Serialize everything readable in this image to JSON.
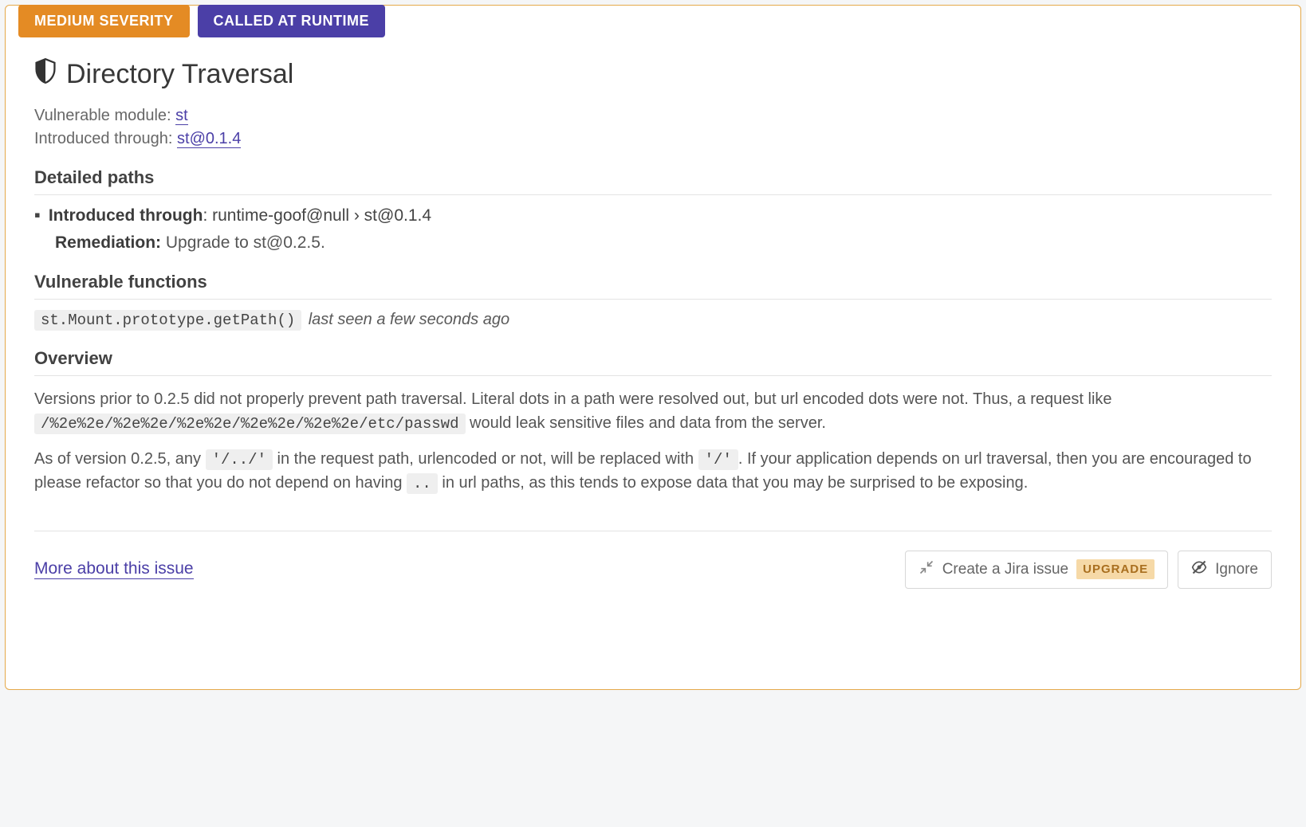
{
  "badges": {
    "severity": "MEDIUM SEVERITY",
    "runtime": "CALLED AT RUNTIME"
  },
  "title": "Directory Traversal",
  "meta": {
    "vuln_module_label": "Vulnerable module: ",
    "vuln_module_link": "st",
    "introduced_label": "Introduced through: ",
    "introduced_link": "st@0.1.4"
  },
  "sections": {
    "detailed_paths": "Detailed paths",
    "vulnerable_functions": "Vulnerable functions",
    "overview": "Overview"
  },
  "paths": {
    "introduced_label": "Introduced through",
    "introduced_value": ": runtime-goof@null › st@0.1.4",
    "remediation_label": "Remediation:",
    "remediation_value": " Upgrade to st@0.2.5."
  },
  "funcs": {
    "signature": "st.Mount.prototype.getPath()",
    "last_seen": "last seen a few seconds ago"
  },
  "overview": {
    "p1_a": "Versions prior to 0.2.5 did not properly prevent path traversal. Literal dots in a path were resolved out, but url encoded dots were not. Thus, a request like ",
    "p1_code": "/%2e%2e/%2e%2e/%2e%2e/%2e%2e/%2e%2e/etc/passwd",
    "p1_b": " would leak sensitive files and data from the server.",
    "p2_a": "As of version 0.2.5, any ",
    "p2_code1": "'/../'",
    "p2_b": " in the request path, urlencoded or not, will be replaced with ",
    "p2_code2": "'/'",
    "p2_c": ". If your application depends on url traversal, then you are encouraged to please refactor so that you do not depend on having ",
    "p2_code3": "..",
    "p2_d": " in url paths, as this tends to expose data that you may be surprised to be exposing."
  },
  "footer": {
    "more": "More about this issue",
    "jira": "Create a Jira issue",
    "upgrade": "UPGRADE",
    "ignore": "Ignore"
  }
}
